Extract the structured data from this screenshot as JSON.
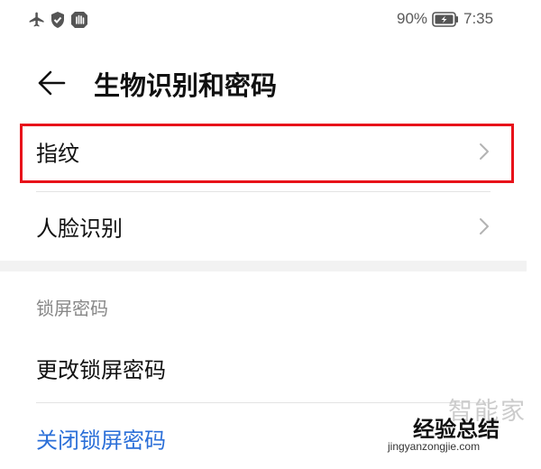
{
  "status_bar": {
    "icons": [
      "airplane-icon",
      "shield-icon",
      "hand-icon"
    ],
    "battery_percent": "90%",
    "battery_icon": "battery-charging-icon",
    "time": "7:35"
  },
  "header": {
    "back_icon": "arrow-left-icon",
    "title": "生物识别和密码"
  },
  "biometrics": {
    "items": [
      {
        "label": "指纹",
        "chevron": "chevron-right-icon",
        "highlighted": true
      },
      {
        "label": "人脸识别",
        "chevron": "chevron-right-icon",
        "highlighted": false
      }
    ]
  },
  "lock_screen": {
    "section_title": "锁屏密码",
    "change_label": "更改锁屏密码",
    "disable_label": "关闭锁屏密码"
  },
  "watermark": {
    "brand": "智能家",
    "main": "经验总结",
    "url": "jingyanzongjie.com"
  },
  "colors": {
    "highlight_border": "#e8121a",
    "link_blue": "#2b6fd8",
    "section_header": "#888888",
    "divider": "#e3e3e3",
    "section_gap": "#f2f2f2"
  }
}
